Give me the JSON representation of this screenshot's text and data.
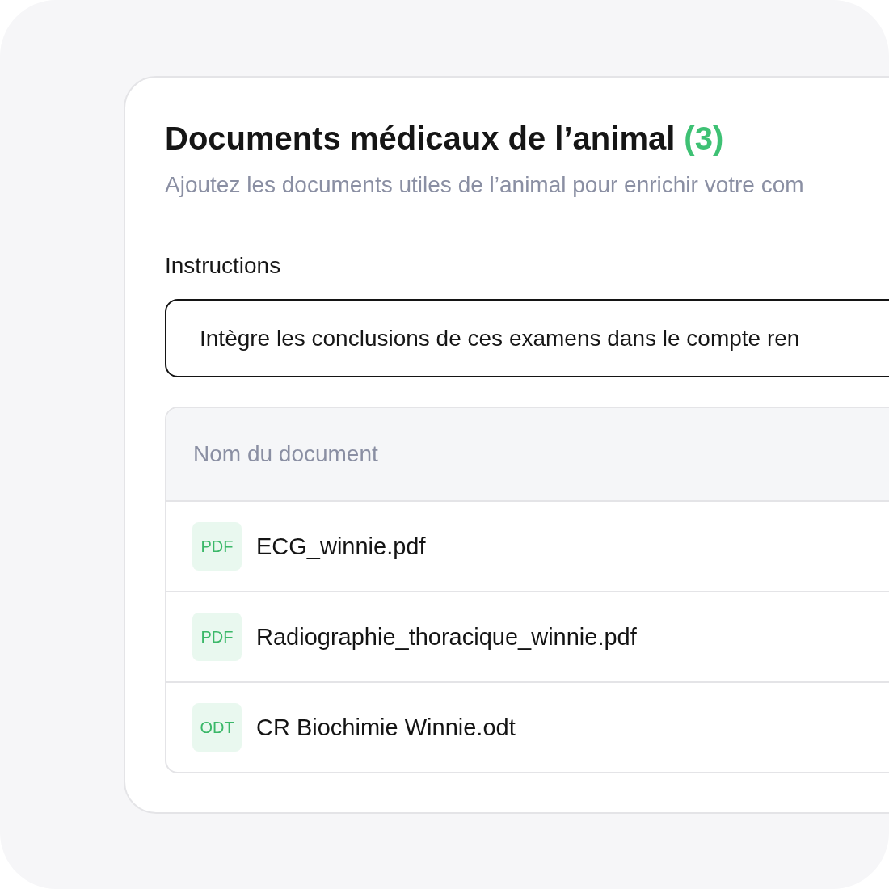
{
  "card": {
    "title": "Documents médicaux de l’animal",
    "count": "(3)",
    "subtitle": "Ajoutez les documents utiles de l’animal pour enrichir votre com"
  },
  "instructions": {
    "label": "Instructions",
    "value": "Intègre les conclusions de ces examens dans le compte ren"
  },
  "table": {
    "columns": [
      "Nom du document"
    ],
    "rows": [
      {
        "file_type": "PDF",
        "name": "ECG_winnie.pdf"
      },
      {
        "file_type": "PDF",
        "name": "Radiographie_thoracique_winnie.pdf"
      },
      {
        "file_type": "ODT",
        "name": "CR Biochimie Winnie.odt"
      }
    ]
  }
}
